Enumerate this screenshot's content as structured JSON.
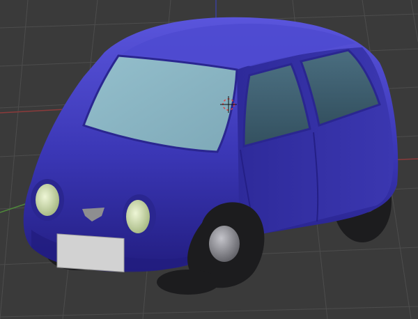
{
  "viewport": {
    "background_color": "#3a3a3a",
    "grid_line_color": "#4d4d4d",
    "x_axis_color": "#8b3a3a",
    "y_axis_color": "#4f8a3a",
    "z_axis_color": "#3a3f9a",
    "cursor_icon": "3d-cursor-icon"
  },
  "model": {
    "body_color": "#3a36b4",
    "body_highlight_color": "#5450d8",
    "body_shadow_color": "#241f86",
    "window_color": "#8ab6c4",
    "side_window_color": "#3f5f72",
    "tire_color": "#1c1c1e",
    "hub_color": "#8a8a90",
    "headlight_color": "#cfe2a8",
    "license_plate_color": "#d2d2d2",
    "badge_color": "#8e8e90"
  }
}
